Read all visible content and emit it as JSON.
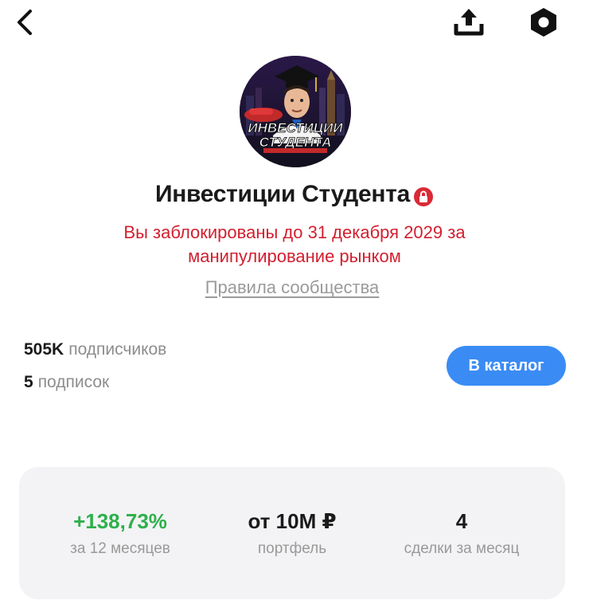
{
  "profile": {
    "title": "Инвестиции Студента",
    "avatar_text_line1": "ИНВЕСТИЦИИ",
    "avatar_text_line2": "СТУДЕНТА",
    "blocked_message": "Вы заблокированы до 31 декабря 2029 за манипулирование рынком",
    "rules_link": "Правила сообщества"
  },
  "stats": {
    "followers_count": "505K",
    "followers_label": "подписчиков",
    "following_count": "5",
    "following_label": "подписок"
  },
  "actions": {
    "catalog_button": "В каталог"
  },
  "metrics": [
    {
      "value": "+138,73%",
      "label": "за 12 месяцев"
    },
    {
      "value": "от 10М ₽",
      "label": "портфель"
    },
    {
      "value": "4",
      "label": "сделки за месяц"
    }
  ],
  "icons": {
    "back": "chevron-left-icon",
    "share": "share-upload-icon",
    "settings": "hexagon-settings-icon",
    "lock": "lock-icon"
  },
  "colors": {
    "blocked_text": "#d21f2f",
    "positive": "#2fb04c",
    "button": "#3a8cf4"
  }
}
